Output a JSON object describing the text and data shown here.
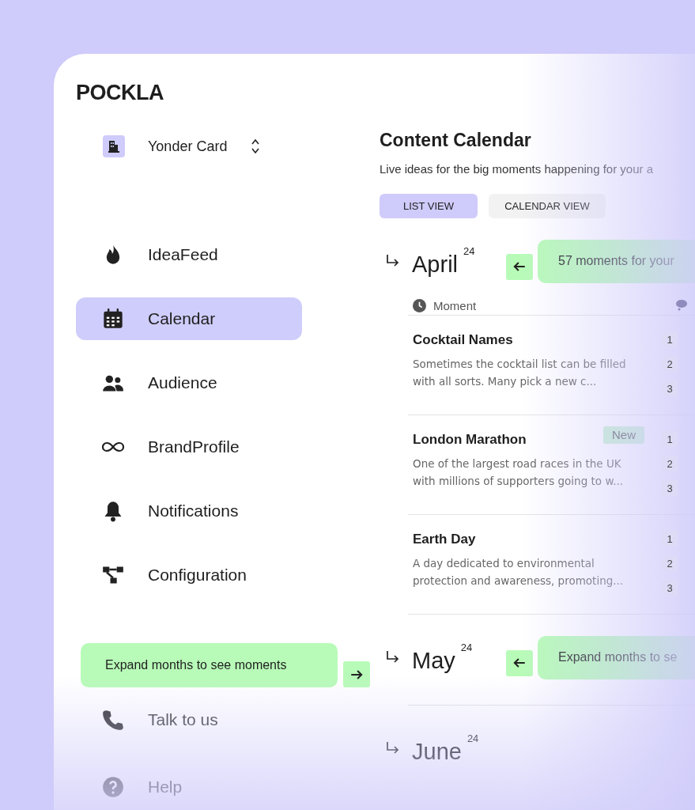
{
  "logo": "POCKLA",
  "workspace": {
    "name": "Yonder Card"
  },
  "nav": [
    {
      "label": "IdeaFeed",
      "kind": "flame",
      "selected": false
    },
    {
      "label": "Calendar",
      "kind": "calendar",
      "selected": true
    },
    {
      "label": "Audience",
      "kind": "people",
      "selected": false
    },
    {
      "label": "BrandProfile",
      "kind": "infinity",
      "selected": false
    },
    {
      "label": "Notifications",
      "kind": "bell",
      "selected": false
    },
    {
      "label": "Configuration",
      "kind": "nodes",
      "selected": false
    }
  ],
  "tooltip": {
    "text": "Expand months to see moments"
  },
  "footer_nav": [
    {
      "label": "Talk to us",
      "kind": "phone"
    },
    {
      "label": "Help",
      "kind": "help"
    }
  ],
  "page": {
    "title": "Content Calendar",
    "subtitle": "Live ideas for the big moments happening for your a"
  },
  "view_tabs": [
    {
      "label": "LIST VIEW",
      "selected": true
    },
    {
      "label": "CALENDAR VIEW",
      "selected": false
    }
  ],
  "columns": [
    "Moment"
  ],
  "months": [
    {
      "name": "April",
      "year": "24",
      "banner": "57 moments for your",
      "rows": [
        {
          "title": "Cocktail Names",
          "description": "Sometimes the cocktail list can be filled with all sorts. Many pick a new c...",
          "ranks": [
            "1",
            "2",
            "3"
          ]
        },
        {
          "title": "London Marathon",
          "description": "One of the largest road races in the UK with millions of supporters going to w...",
          "new_badge": "New",
          "ranks": [
            "1",
            "2",
            "3"
          ]
        },
        {
          "title": "Earth Day",
          "description": "A day dedicated to environmental protection and awareness, promoting...",
          "ranks": [
            "1",
            "2",
            "3"
          ]
        }
      ]
    },
    {
      "name": "May",
      "year": "24",
      "banner": "Expand months to se"
    },
    {
      "name": "June",
      "year": "24"
    }
  ]
}
